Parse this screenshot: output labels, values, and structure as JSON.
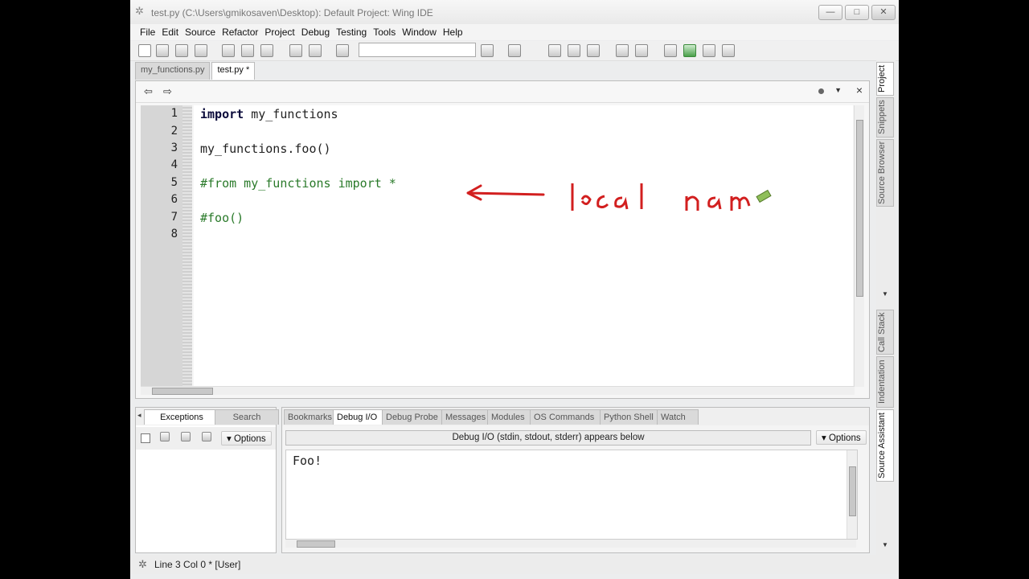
{
  "window": {
    "title": "test.py (C:\\Users\\gmikosaven\\Desktop): Default Project: Wing IDE",
    "min_glyph": "—",
    "max_glyph": "□",
    "close_glyph": "✕"
  },
  "menu": [
    "File",
    "Edit",
    "Source",
    "Refactor",
    "Project",
    "Debug",
    "Testing",
    "Tools",
    "Window",
    "Help"
  ],
  "editor_tabs": [
    {
      "label": "my_functions.py",
      "active": false
    },
    {
      "label": "test.py *",
      "active": true
    }
  ],
  "editor": {
    "nav_back": "⇦",
    "nav_forward": "⇨",
    "lines": [
      {
        "num": "1",
        "kw": "import",
        "rest": " my_functions",
        "comment": ""
      },
      {
        "num": "2",
        "kw": "",
        "rest": "",
        "comment": ""
      },
      {
        "num": "3",
        "kw": "",
        "rest": "my_functions.foo()",
        "comment": ""
      },
      {
        "num": "4",
        "kw": "",
        "rest": "",
        "comment": ""
      },
      {
        "num": "5",
        "kw": "",
        "rest": "",
        "comment": "#from my_functions import *"
      },
      {
        "num": "6",
        "kw": "",
        "rest": "",
        "comment": ""
      },
      {
        "num": "7",
        "kw": "",
        "rest": "",
        "comment": "#foo()"
      },
      {
        "num": "8",
        "kw": "",
        "rest": "",
        "comment": ""
      }
    ],
    "annotation": "local nam"
  },
  "left_panel": {
    "tabs": [
      "Exceptions",
      "Search"
    ],
    "options_label": "▾ Options"
  },
  "right_panel": {
    "tabs": [
      "Bookmarks",
      "Debug I/O",
      "Debug Probe",
      "Messages",
      "Modules",
      "OS Commands",
      "Python Shell",
      "Watch"
    ],
    "active_tab": "Debug I/O",
    "banner": "Debug I/O (stdin, stdout, stderr) appears below",
    "options_label": "▾ Options",
    "output": "Foo!"
  },
  "side_tabs": [
    "Project",
    "Snippets",
    "Source Browser",
    "Call Stack",
    "Indentation",
    "Source Assistant"
  ],
  "status": {
    "text": "Line 3 Col 0 * [User]"
  }
}
